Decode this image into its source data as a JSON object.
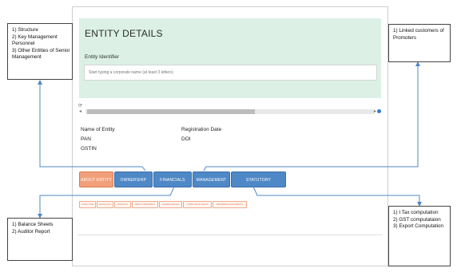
{
  "entity_details": {
    "title": "ENTITY DETAILS",
    "identifier_label": "Entity Identifier",
    "search_placeholder": "Start typing a corporate name (at least 3 letters)"
  },
  "details": {
    "name_of_entity": "Name of Entity",
    "pan": "PAN",
    "gstin": "GSTIN",
    "registration_date": "Registration Date",
    "doi": "DOI"
  },
  "tabs": [
    {
      "label": "ABOUT ENTITY",
      "active": true
    },
    {
      "label": "OWNERSHIP",
      "active": false
    },
    {
      "label": "FINANCIALS",
      "active": false
    },
    {
      "label": "MANAGEMENT",
      "active": false
    },
    {
      "label": "STATUTORY COMPLIANCE",
      "active": false
    }
  ],
  "subtabs": [
    "STRUCTURE",
    "HIGHLIGHTS",
    "FINANCIAL",
    "PEER COMPARISON",
    "CHARGE DETAILS",
    "COMPLIANCE CHECK",
    "REFERENCE DOCUMENTS"
  ],
  "notes": {
    "top_left": [
      "1) Structure",
      "2) Key Management",
      "Personnel",
      "3) Other Entities of Senior",
      "Management"
    ],
    "top_right": [
      "1) Linked customers of",
      "Promoters"
    ],
    "bottom_left": [
      "1) Balance Sheets",
      "2) Auditor Report"
    ],
    "bottom_right": [
      "1) I Tax computation",
      "2) GST computataion",
      "3) Export Computation"
    ]
  },
  "colors": {
    "header_bg": "#dcf0e6",
    "tab_blue": "#4f88c6",
    "tab_active": "#f2a07a",
    "connector": "#4f88c6"
  }
}
